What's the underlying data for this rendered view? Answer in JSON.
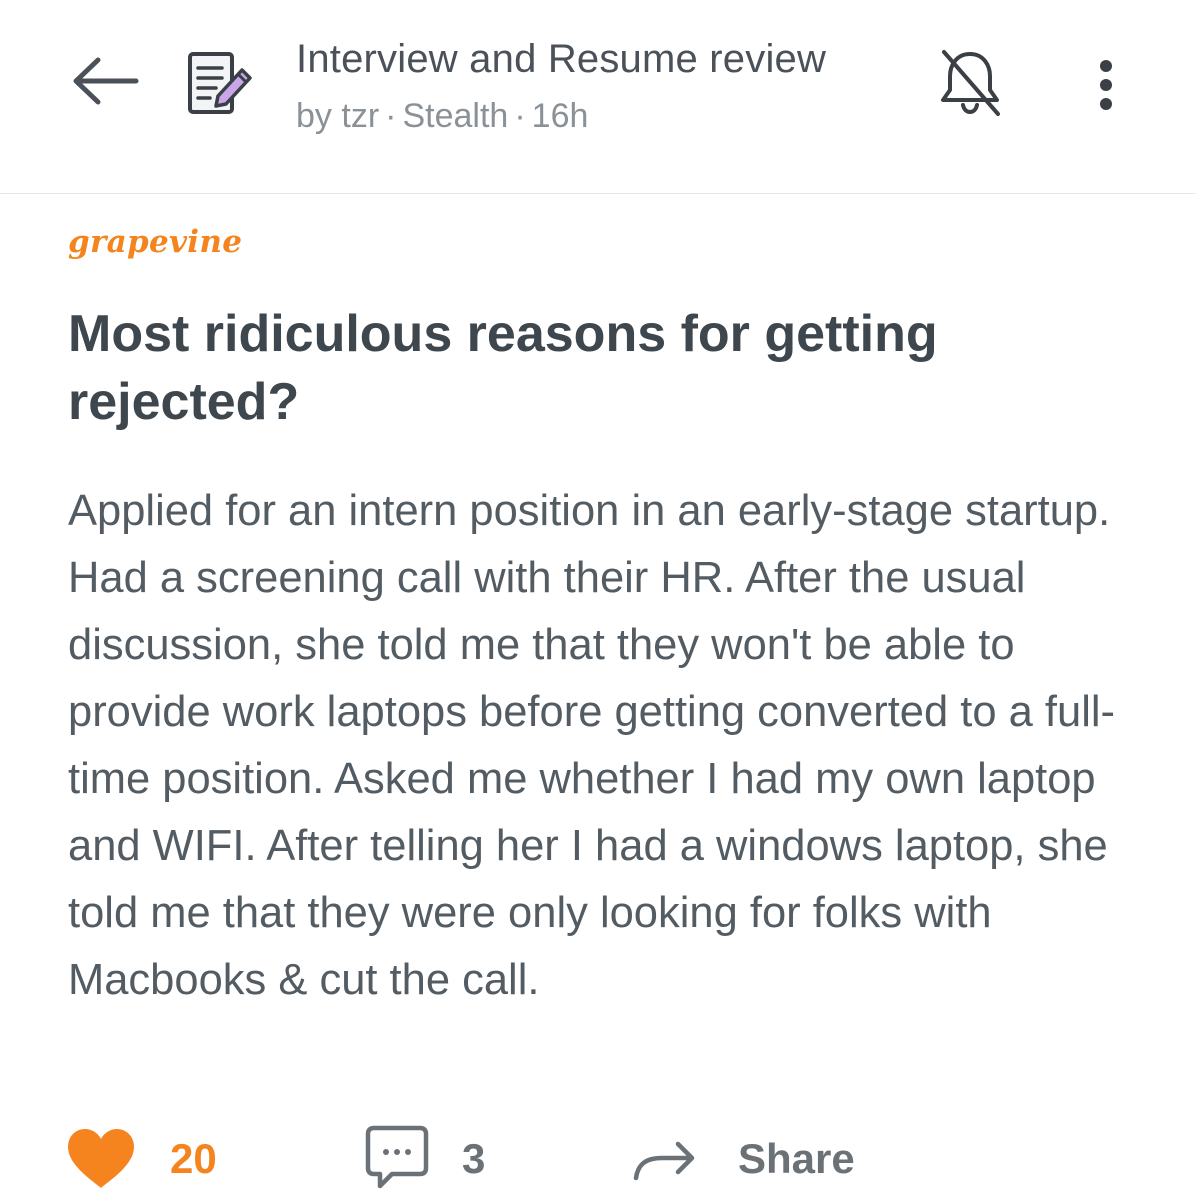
{
  "header": {
    "back_icon": "arrow-left-icon",
    "group_icon": "document-edit-icon",
    "group_title": "Interview and Resume review",
    "meta": {
      "prefix": "by",
      "author": "tzr",
      "company": "Stealth",
      "age": "16h"
    },
    "mute_icon": "bell-off-icon",
    "more_icon": "more-vertical-icon"
  },
  "post": {
    "brand": "grapevine",
    "title": "Most ridiculous reasons for getting rejected?",
    "body": "Applied for an intern position in an early-stage startup. Had a screening call with their HR. After the usual discussion, she told me that they won't be able to provide work laptops before getting converted to a full-time position. Asked me whether I had my own laptop and WIFI. After telling her I had a windows laptop, she told me that they were only looking for folks with Macbooks & cut the call."
  },
  "actions": {
    "like": {
      "icon": "heart-icon",
      "count": "20",
      "color": "#f5841f"
    },
    "comment": {
      "icon": "comment-icon",
      "count": "3"
    },
    "share": {
      "icon": "share-arrow-icon",
      "label": "Share"
    }
  },
  "colors": {
    "accent": "#f5841f",
    "text": "#424a52",
    "muted": "#8a9197"
  }
}
